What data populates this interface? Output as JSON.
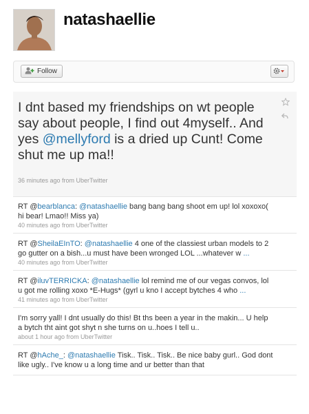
{
  "profile": {
    "username": "natashaellie"
  },
  "actions": {
    "follow_label": "Follow"
  },
  "featured": {
    "text_1": "I dnt based my friendships on wt people say about people, I find out 4myself.. And yes ",
    "mention": "@mellyford",
    "text_2": " is a dried up Cunt! Come shut me up ma!!",
    "meta": "36 minutes ago from UberTwitter"
  },
  "tweets": [
    {
      "prefix": "RT @",
      "user": "bearblanca",
      "colon": ": ",
      "mention": "@natashaellie",
      "text": " bang bang bang shoot em up! lol xoxoxo( hi bear! Lmao!! Miss ya)",
      "more": "",
      "meta": "40 minutes ago from UberTwitter"
    },
    {
      "prefix": "RT @",
      "user": "SheilaEInTO",
      "colon": ": ",
      "mention": "@natashaellie",
      "text": " 4 one of the classiest urban models to 2 go gutter on a bish...u must have been wronged LOL ...whatever w ",
      "more": "...",
      "meta": "40 minutes ago from UberTwitter"
    },
    {
      "prefix": "RT @",
      "user": "iluvTERRICKA",
      "colon": ": ",
      "mention": "@natashaellie",
      "text": " lol remind me of our vegas convos, lol u got me rolling xoxo *E-Hugs* (gyrl u kno I accept bytches 4 who ",
      "more": "...",
      "meta": "41 minutes ago from UberTwitter"
    },
    {
      "prefix": "",
      "user": "",
      "colon": "",
      "mention": "",
      "text": "I'm sorry yall! I dnt usually do this! Bt ths been a year in the makin... U help a bytch tht aint got shyt n she turns on u..hoes I tell u..",
      "more": "",
      "meta": "about 1 hour ago from UberTwitter"
    },
    {
      "prefix": "RT @",
      "user": "hAche_",
      "colon": ": ",
      "mention": "@natashaellie",
      "text": " Tisk.. Tisk.. Tisk.. Be nice baby gurl.. God dont like ugly.. I've know u a long time and ur better than that",
      "more": "",
      "meta": ""
    }
  ],
  "colors": {
    "link": "#2c7ab0",
    "meta": "#999999",
    "featured_bg": "#f6f6f6"
  },
  "icons": [
    "follow-icon",
    "gear-icon",
    "star-icon",
    "reply-icon"
  ]
}
